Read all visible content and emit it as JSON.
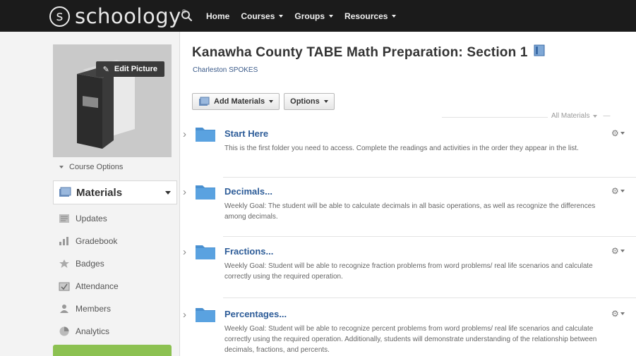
{
  "topbar": {
    "logo_mark": "s",
    "logo_text": "schoology",
    "logo_tm": "®",
    "nav": [
      {
        "label": "Home",
        "has_caret": false
      },
      {
        "label": "Courses",
        "has_caret": true
      },
      {
        "label": "Groups",
        "has_caret": true
      },
      {
        "label": "Resources",
        "has_caret": true
      }
    ]
  },
  "sidebar": {
    "edit_picture_label": "Edit Picture",
    "course_options_label": "Course Options",
    "active_item": {
      "label": "Materials",
      "icon": "materials-icon"
    },
    "items": [
      {
        "label": "Updates",
        "icon": "updates-icon"
      },
      {
        "label": "Gradebook",
        "icon": "gradebook-icon"
      },
      {
        "label": "Badges",
        "icon": "badges-icon"
      },
      {
        "label": "Attendance",
        "icon": "attendance-icon"
      },
      {
        "label": "Members",
        "icon": "members-icon"
      },
      {
        "label": "Analytics",
        "icon": "analytics-icon"
      }
    ]
  },
  "main": {
    "title": "Kanawha County TABE Math Preparation: Section 1",
    "subtitle": "Charleston SPOKES",
    "add_materials_label": "Add Materials",
    "options_label": "Options",
    "filter_label": "All Materials",
    "folders": [
      {
        "title": "Start Here",
        "description": "This is the first folder you need to access. Complete the readings and activities in the order they appear in the list."
      },
      {
        "title": "Decimals...",
        "description": "Weekly Goal: The student will be able to calculate decimals in all basic operations, as well as recognize the differences among decimals."
      },
      {
        "title": "Fractions...",
        "description": "Weekly Goal: Student will be able to recognize fraction problems from word problems/ real life scenarios and calculate correctly using the required operation."
      },
      {
        "title": "Percentages...",
        "description": "Weekly Goal: Student will be able to recognize percent problems from word problems/ real life scenarios and calculate correctly using the required operation. Additionally, students will demonstrate understanding of the relationship between decimals, fractions, and percents."
      }
    ]
  },
  "colors": {
    "topbar_bg": "#1b1b1b",
    "link_blue": "#2d5c98",
    "folder_blue": "#4a90d0",
    "accent_green": "#8cc151"
  }
}
